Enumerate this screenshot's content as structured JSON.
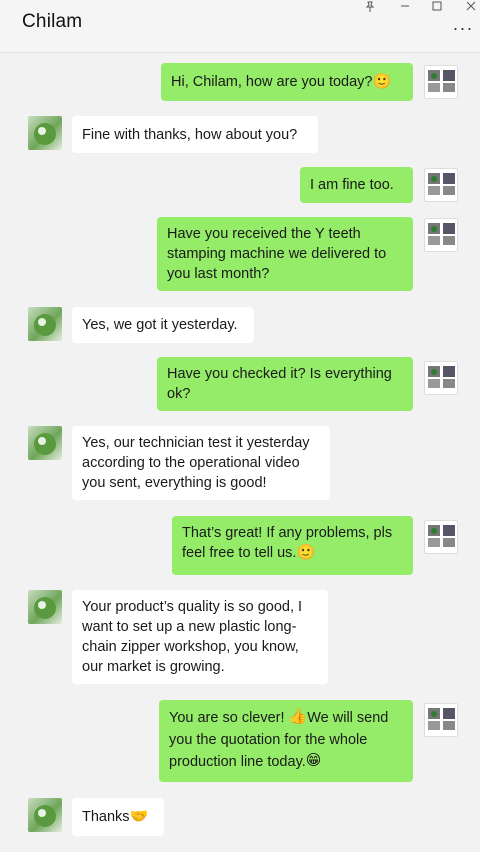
{
  "header": {
    "title": "Chilam",
    "window_controls": [
      "pin-icon",
      "minimize-icon",
      "maximize-icon",
      "close-icon"
    ],
    "more_icon": "more-icon"
  },
  "messages": [
    {
      "from": "self",
      "text": "Hi, Chilam, how are you today?",
      "emoji": "🙂"
    },
    {
      "from": "other",
      "text": "Fine with thanks, how about you?"
    },
    {
      "from": "self",
      "text": "I am fine too."
    },
    {
      "from": "self",
      "text": "Have you received the Y teeth stamping machine we delivered to you last month?"
    },
    {
      "from": "other",
      "text": "Yes, we got it yesterday."
    },
    {
      "from": "self",
      "text": "Have you checked it? Is everything ok?"
    },
    {
      "from": "other",
      "text": "Yes, our technician test it yesterday according to the operational video you sent, everything is good!"
    },
    {
      "from": "self",
      "text": "That’s great! If any problems, pls feel free to tell us.",
      "emoji": "🙂"
    },
    {
      "from": "other",
      "text": "Your product’s quality is so good, I want to set up a new plastic long-chain zipper workshop, you know, our market is growing."
    },
    {
      "from": "self",
      "text": "You are so clever! ",
      "emoji": "👍",
      "text2": "We will send you the quotation for the whole production line today.",
      "emoji2": "😁"
    },
    {
      "from": "other",
      "text": "Thanks",
      "emoji": "🤝"
    }
  ],
  "colors": {
    "self_bubble": "#95ec69",
    "other_bubble": "#ffffff",
    "background": "#f2f2f2"
  }
}
